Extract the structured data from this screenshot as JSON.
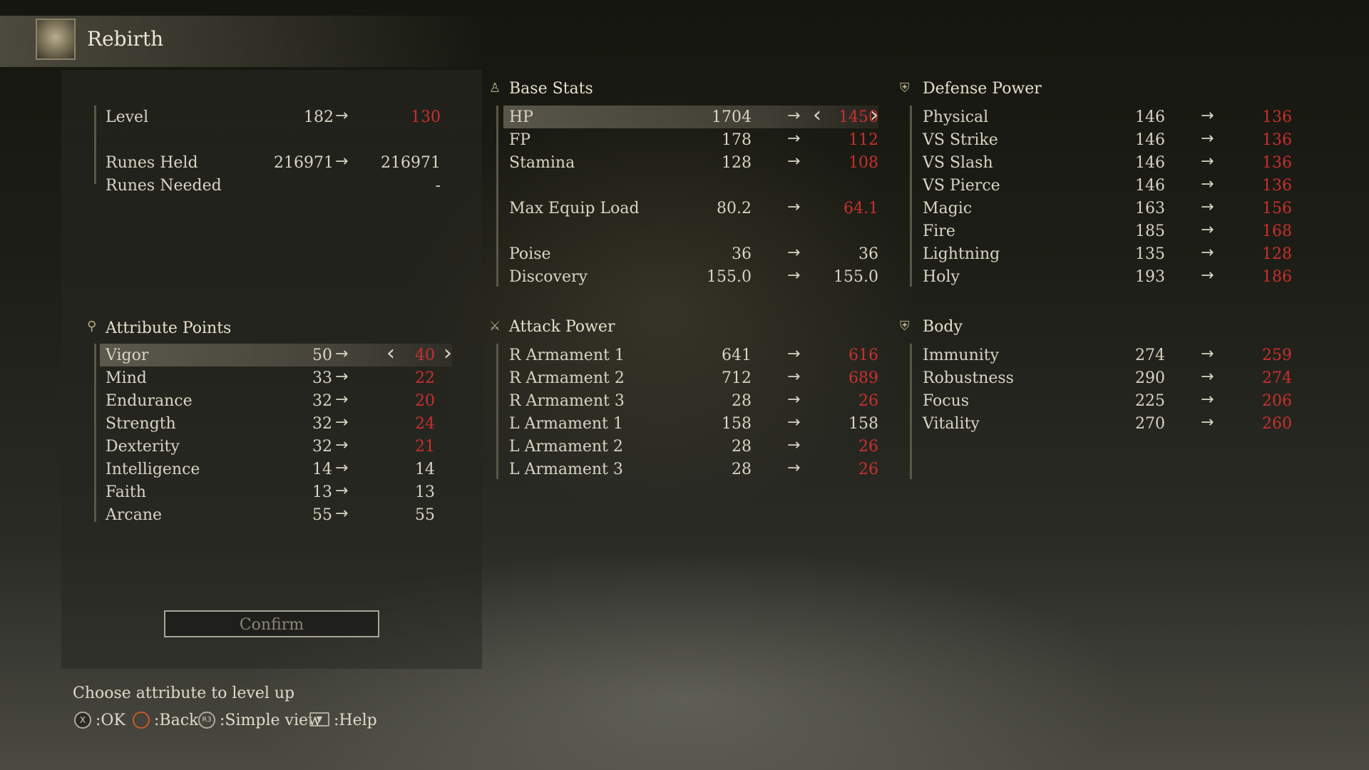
{
  "header": {
    "title": "Rebirth",
    "emblem_icon": "rebirth-emblem-icon"
  },
  "level_block": {
    "level": {
      "label": "Level",
      "current": "182",
      "new": "130"
    },
    "runes_held": {
      "label": "Runes Held",
      "current": "216971",
      "new": "216971"
    },
    "runes_needed": {
      "label": "Runes Needed",
      "value": "-"
    }
  },
  "attribute_points": {
    "title": "Attribute Points",
    "items": [
      {
        "label": "Vigor",
        "current": "50",
        "new": "40",
        "changed": true
      },
      {
        "label": "Mind",
        "current": "33",
        "new": "22",
        "changed": true
      },
      {
        "label": "Endurance",
        "current": "32",
        "new": "20",
        "changed": true
      },
      {
        "label": "Strength",
        "current": "32",
        "new": "24",
        "changed": true
      },
      {
        "label": "Dexterity",
        "current": "32",
        "new": "21",
        "changed": true
      },
      {
        "label": "Intelligence",
        "current": "14",
        "new": "14",
        "changed": false
      },
      {
        "label": "Faith",
        "current": "13",
        "new": "13",
        "changed": false
      },
      {
        "label": "Arcane",
        "current": "55",
        "new": "55",
        "changed": false
      }
    ]
  },
  "confirm_label": "Confirm",
  "base_stats": {
    "title": "Base Stats",
    "hp": {
      "label": "HP",
      "current": "1704",
      "new": "1450"
    },
    "fp": {
      "label": "FP",
      "current": "178",
      "new": "112"
    },
    "stamina": {
      "label": "Stamina",
      "current": "128",
      "new": "108"
    },
    "equip_load": {
      "label": "Max Equip Load",
      "current": "80.2",
      "new": "64.1"
    },
    "poise": {
      "label": "Poise",
      "current": "36",
      "new": "36"
    },
    "discovery": {
      "label": "Discovery",
      "current": "155.0",
      "new": "155.0"
    }
  },
  "attack_power": {
    "title": "Attack Power",
    "items": [
      {
        "label": "R Armament 1",
        "current": "641",
        "new": "616",
        "changed": true
      },
      {
        "label": "R Armament 2",
        "current": "712",
        "new": "689",
        "changed": true
      },
      {
        "label": "R Armament 3",
        "current": "28",
        "new": "26",
        "changed": true
      },
      {
        "label": "L Armament 1",
        "current": "158",
        "new": "158",
        "changed": false
      },
      {
        "label": "L Armament 2",
        "current": "28",
        "new": "26",
        "changed": true
      },
      {
        "label": "L Armament 3",
        "current": "28",
        "new": "26",
        "changed": true
      }
    ]
  },
  "defense_power": {
    "title": "Defense Power",
    "items": [
      {
        "label": "Physical",
        "current": "146",
        "new": "136"
      },
      {
        "label": "VS Strike",
        "current": "146",
        "new": "136"
      },
      {
        "label": "VS Slash",
        "current": "146",
        "new": "136"
      },
      {
        "label": "VS Pierce",
        "current": "146",
        "new": "136"
      },
      {
        "label": "Magic",
        "current": "163",
        "new": "156"
      },
      {
        "label": "Fire",
        "current": "185",
        "new": "168"
      },
      {
        "label": "Lightning",
        "current": "135",
        "new": "128"
      },
      {
        "label": "Holy",
        "current": "193",
        "new": "186"
      }
    ]
  },
  "body": {
    "title": "Body",
    "items": [
      {
        "label": "Immunity",
        "current": "274",
        "new": "259"
      },
      {
        "label": "Robustness",
        "current": "290",
        "new": "274"
      },
      {
        "label": "Focus",
        "current": "225",
        "new": "206"
      },
      {
        "label": "Vitality",
        "current": "270",
        "new": "260"
      }
    ]
  },
  "arrow_symbol": "→",
  "prompt": "Choose attribute to level up",
  "help": {
    "ok": ":OK",
    "back": ":Back",
    "simple_view": ":Simple view",
    "help": ":Help",
    "ok_glyph": "X",
    "back_glyph": "O",
    "simple_glyph": "R3",
    "help_glyph": "▼"
  },
  "colors": {
    "decrease": "#c8302e",
    "text": "#d9d4c4"
  }
}
